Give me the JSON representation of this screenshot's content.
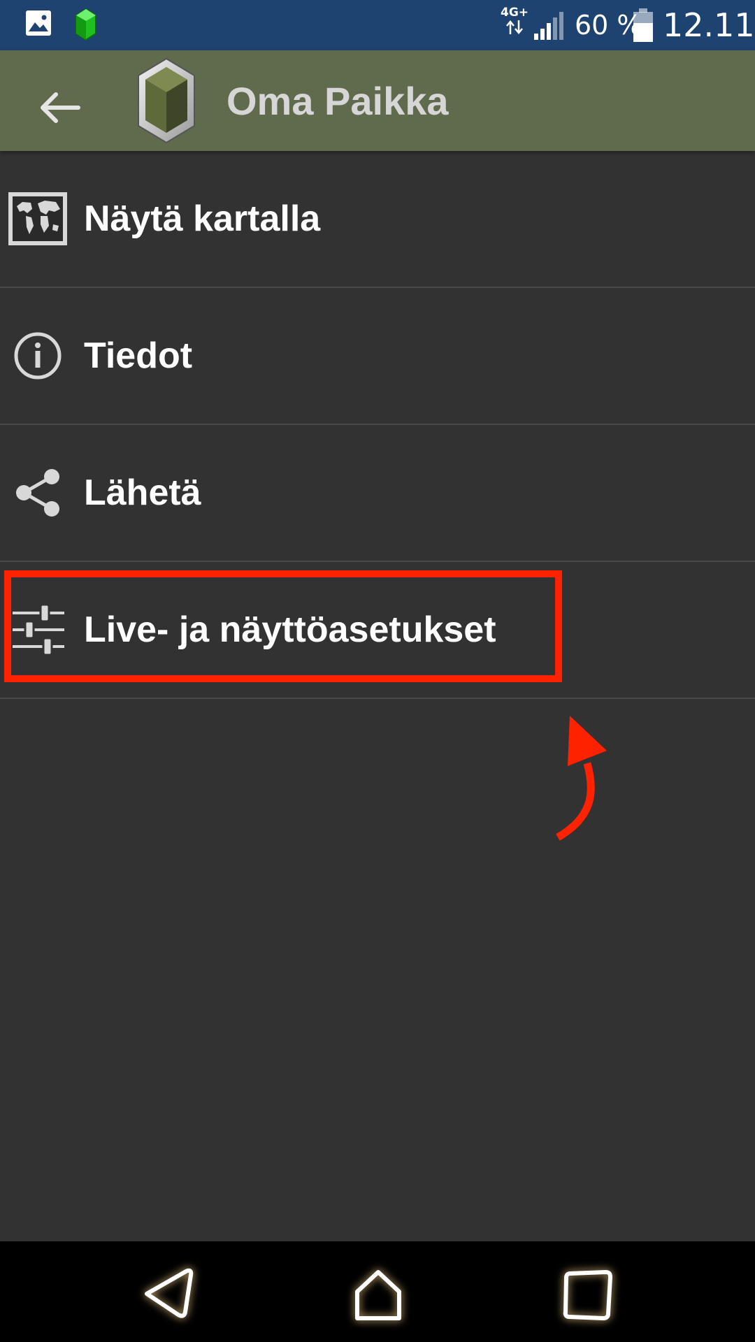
{
  "status_bar": {
    "network": "4G+",
    "battery_text": "60 %",
    "time": "12.11"
  },
  "app_bar": {
    "title": "Oma Paikka"
  },
  "menu": [
    {
      "label": "Näytä kartalla",
      "icon": "world-map-icon"
    },
    {
      "label": "Tiedot",
      "icon": "info-icon"
    },
    {
      "label": "Lähetä",
      "icon": "share-icon"
    },
    {
      "label": "Live- ja näyttöasetukset",
      "icon": "sliders-icon"
    }
  ],
  "annotation": {
    "highlight_color": "#ff2200",
    "highlighted_item": "Live- ja näyttöasetukset"
  },
  "nav_bar": {
    "buttons": [
      "back-icon",
      "home-icon",
      "recents-icon"
    ]
  },
  "colors": {
    "status_bar": "#1e4370",
    "app_bar": "#606b4e",
    "background": "#323232"
  }
}
